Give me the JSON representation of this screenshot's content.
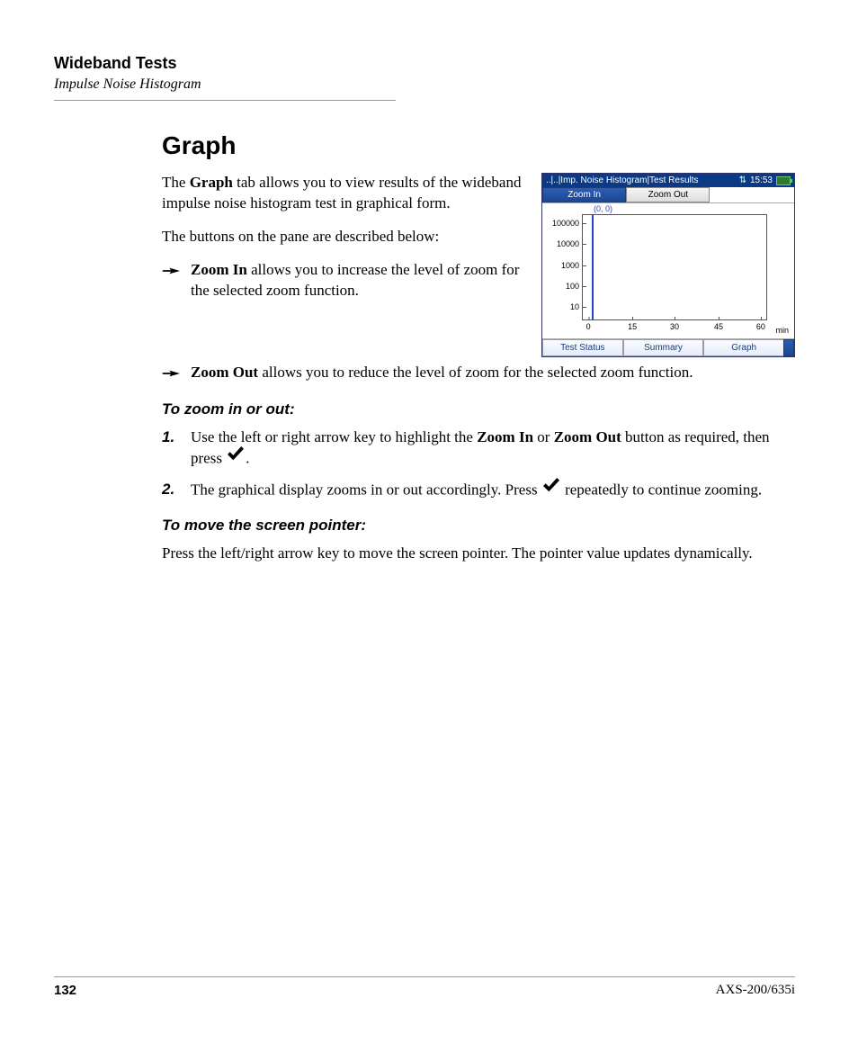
{
  "header": {
    "title": "Wideband Tests",
    "subtitle": "Impulse Noise Histogram"
  },
  "section_title": "Graph",
  "intro": {
    "p1_pre": "The ",
    "p1_bold": "Graph",
    "p1_post": " tab allows you to view results of the wideband impulse noise histogram test in graphical form.",
    "p2": "The buttons on the pane are described below:"
  },
  "bullets": {
    "zoom_in": {
      "label": "Zoom In",
      "text": " allows you to increase the level of zoom for the selected zoom function."
    },
    "zoom_out": {
      "label": "Zoom Out",
      "text": " allows you to reduce the level of zoom for the selected zoom function."
    }
  },
  "procedures": {
    "zoom_heading": "To zoom in or out:",
    "step1_pre": "Use the left or right arrow key to highlight the ",
    "step1_b1": "Zoom In",
    "step1_mid": " or ",
    "step1_b2": "Zoom Out",
    "step1_post": " button as required, then press ",
    "step1_end": ".",
    "step2_pre": "The graphical display zooms in or out accordingly. Press ",
    "step2_post": " repeatedly to continue zooming.",
    "pointer_heading": "To move the screen pointer:",
    "pointer_text": "Press the left/right arrow key to move the screen pointer. The pointer value updates dynamically.",
    "marker1": "1.",
    "marker2": "2."
  },
  "device": {
    "title": "..|..|Imp. Noise Histogram|Test Results",
    "time": "15:53",
    "buttons": {
      "zoom_in": "Zoom In",
      "zoom_out": "Zoom Out"
    },
    "cursor_label": "(0, 0)",
    "x_unit": "min",
    "tabs": {
      "test_status": "Test Status",
      "summary": "Summary",
      "graph": "Graph"
    }
  },
  "chart_data": {
    "type": "line",
    "title": "",
    "xlabel": "min",
    "ylabel": "",
    "x_ticks": [
      0,
      15,
      30,
      45,
      60
    ],
    "y_ticks": [
      10,
      100,
      1000,
      10000,
      100000
    ],
    "xlim": [
      0,
      60
    ],
    "ylim_log": [
      10,
      100000
    ],
    "cursor": {
      "x": 0,
      "y": 0
    },
    "series": [
      {
        "name": "impulse-noise",
        "x": [],
        "y": []
      }
    ]
  },
  "footer": {
    "page": "132",
    "model": "AXS-200/635i"
  }
}
